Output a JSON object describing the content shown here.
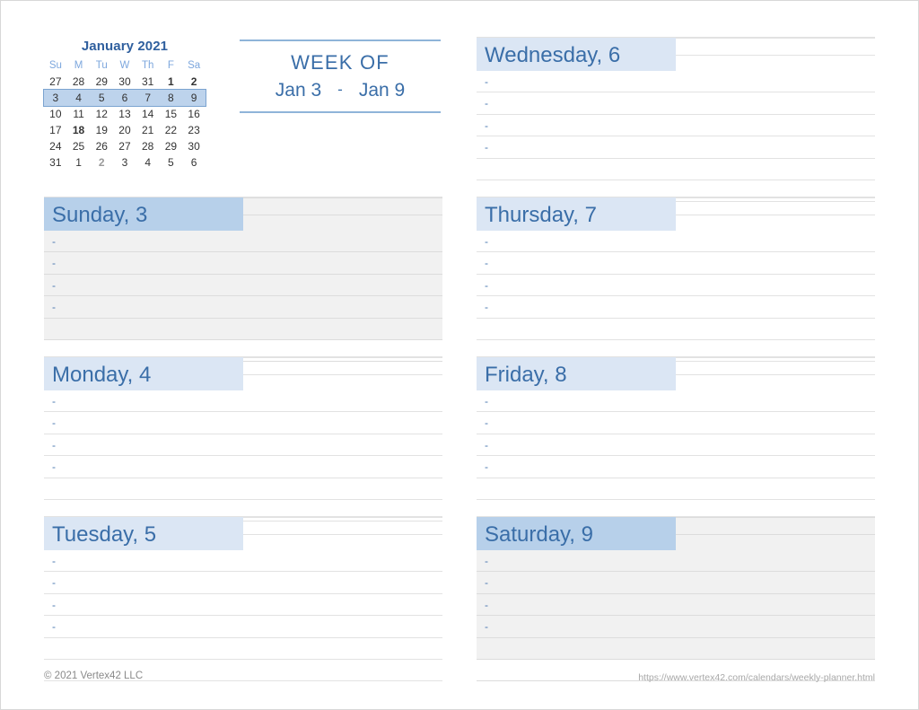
{
  "mini_calendar": {
    "title": "January 2021",
    "weekday_headers": [
      "Su",
      "M",
      "Tu",
      "W",
      "Th",
      "F",
      "Sa"
    ],
    "weeks": [
      {
        "highlighted": false,
        "days": [
          {
            "n": "27",
            "state": "other"
          },
          {
            "n": "28",
            "state": "other"
          },
          {
            "n": "29",
            "state": "other"
          },
          {
            "n": "30",
            "state": "other"
          },
          {
            "n": "31",
            "state": "other"
          },
          {
            "n": "1",
            "state": "holiday"
          },
          {
            "n": "2",
            "state": "holiday"
          }
        ]
      },
      {
        "highlighted": true,
        "days": [
          {
            "n": "3",
            "state": "current"
          },
          {
            "n": "4",
            "state": "current"
          },
          {
            "n": "5",
            "state": "current"
          },
          {
            "n": "6",
            "state": "current"
          },
          {
            "n": "7",
            "state": "current"
          },
          {
            "n": "8",
            "state": "current"
          },
          {
            "n": "9",
            "state": "current"
          }
        ]
      },
      {
        "highlighted": false,
        "days": [
          {
            "n": "10",
            "state": "current"
          },
          {
            "n": "11",
            "state": "current"
          },
          {
            "n": "12",
            "state": "current"
          },
          {
            "n": "13",
            "state": "current"
          },
          {
            "n": "14",
            "state": "current"
          },
          {
            "n": "15",
            "state": "current"
          },
          {
            "n": "16",
            "state": "current"
          }
        ]
      },
      {
        "highlighted": false,
        "days": [
          {
            "n": "17",
            "state": "current"
          },
          {
            "n": "18",
            "state": "holiday"
          },
          {
            "n": "19",
            "state": "current"
          },
          {
            "n": "20",
            "state": "current"
          },
          {
            "n": "21",
            "state": "current"
          },
          {
            "n": "22",
            "state": "current"
          },
          {
            "n": "23",
            "state": "current"
          }
        ]
      },
      {
        "highlighted": false,
        "days": [
          {
            "n": "24",
            "state": "current"
          },
          {
            "n": "25",
            "state": "current"
          },
          {
            "n": "26",
            "state": "current"
          },
          {
            "n": "27",
            "state": "current"
          },
          {
            "n": "28",
            "state": "current"
          },
          {
            "n": "29",
            "state": "current"
          },
          {
            "n": "30",
            "state": "current"
          }
        ]
      },
      {
        "highlighted": false,
        "days": [
          {
            "n": "31",
            "state": "current"
          },
          {
            "n": "1",
            "state": "other"
          },
          {
            "n": "2",
            "state": "other-holiday"
          },
          {
            "n": "3",
            "state": "other"
          },
          {
            "n": "4",
            "state": "other"
          },
          {
            "n": "5",
            "state": "other"
          },
          {
            "n": "6",
            "state": "other"
          }
        ]
      }
    ]
  },
  "week_of": {
    "label": "WEEK OF",
    "start": "Jan 3",
    "separator": "-",
    "end": "Jan 9"
  },
  "days": {
    "sunday": {
      "title": "Sunday, 3",
      "type": "weekend",
      "bullets": [
        "-",
        "-",
        "-",
        "-",
        "",
        ""
      ]
    },
    "monday": {
      "title": "Monday, 4",
      "type": "weekday",
      "bullets": [
        "-",
        "-",
        "-",
        "-",
        "",
        ""
      ]
    },
    "tuesday": {
      "title": "Tuesday, 5",
      "type": "weekday",
      "bullets": [
        "-",
        "-",
        "-",
        "-",
        "",
        ""
      ]
    },
    "wednesday": {
      "title": "Wednesday, 6",
      "type": "weekday",
      "bullets": [
        "-",
        "-",
        "-",
        "-",
        "",
        ""
      ]
    },
    "thursday": {
      "title": "Thursday, 7",
      "type": "weekday",
      "bullets": [
        "-",
        "-",
        "-",
        "-",
        "",
        ""
      ]
    },
    "friday": {
      "title": "Friday, 8",
      "type": "weekday",
      "bullets": [
        "-",
        "-",
        "-",
        "-",
        "",
        ""
      ]
    },
    "saturday": {
      "title": "Saturday, 9",
      "type": "weekend",
      "bullets": [
        "-",
        "-",
        "-",
        "-",
        "",
        ""
      ]
    }
  },
  "footer": {
    "copyright": "© 2021 Vertex42 LLC",
    "url": "https://www.vertex42.com/calendars/weekly-planner.html"
  },
  "colors": {
    "accent_blue": "#3a6ea8",
    "title_blue": "#2f5f9e",
    "weekend_header": "#b7d0ea",
    "weekday_header": "#dbe6f4",
    "weekend_body": "#f1f1f1",
    "rule_line": "#e2e2e2",
    "header_weekday_text": "#7da7dd"
  }
}
